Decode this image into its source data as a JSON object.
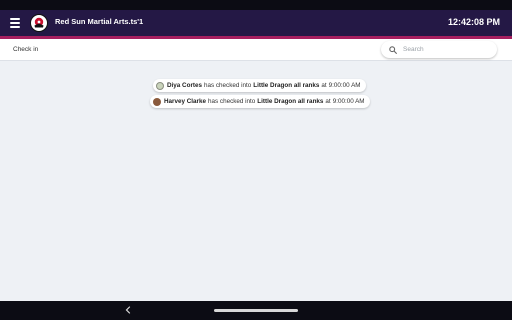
{
  "app_bar": {
    "title": "Red Sun Martial Arts.ts'1",
    "clock": "12:42:08 PM",
    "menu_icon": "hamburger-menu-icon",
    "logo_icon": "red-sun-logo-icon",
    "colors": {
      "app_bar": "#241845",
      "accent": "#a61f5f"
    }
  },
  "toolbar": {
    "page_title": "Check in",
    "search_placeholder": "Search",
    "search_icon": "search-icon"
  },
  "checkins": [
    {
      "name": "Diya Cortes",
      "text_before": "has checked into",
      "class_name": "Little Dragon all ranks",
      "text_at": "at",
      "time": "9:00:00 AM",
      "avatar_color": "#c9d3bb"
    },
    {
      "name": "Harvey Clarke",
      "text_before": "has checked into",
      "class_name": "Little Dragon all ranks",
      "text_at": "at",
      "time": "9:00:00 AM",
      "avatar_color": "#8a5a3c"
    }
  ],
  "nav_bar": {
    "back_icon": "chevron-left-icon",
    "home_icon": "home-pill-icon"
  }
}
